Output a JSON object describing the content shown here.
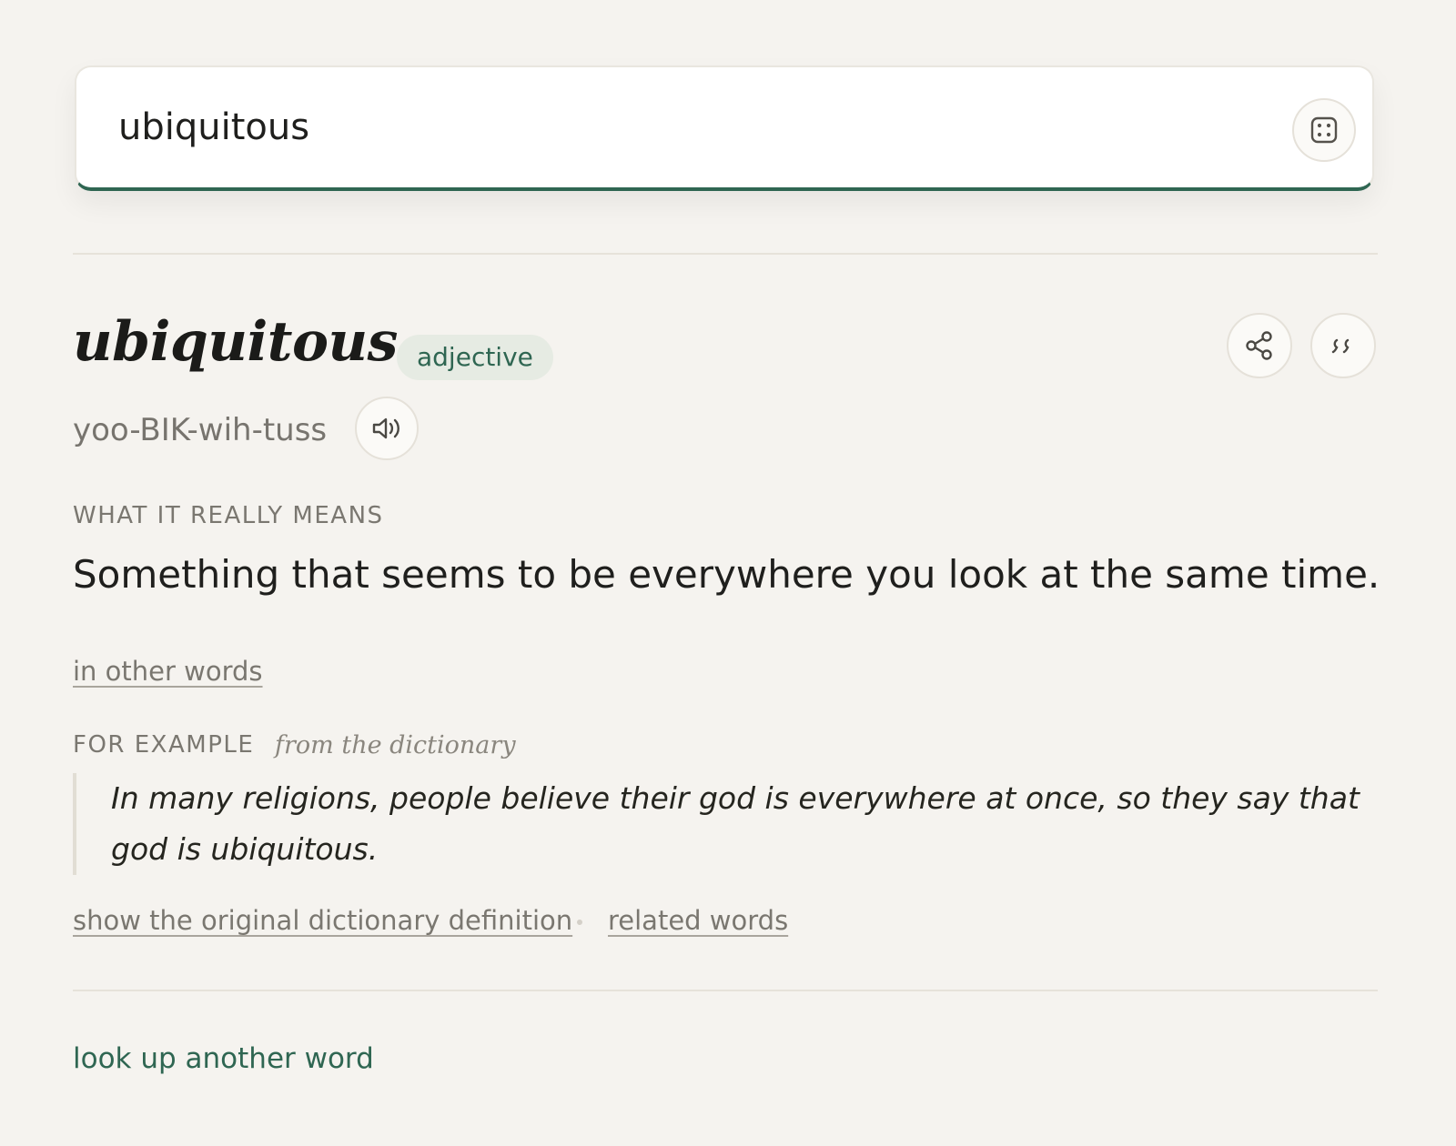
{
  "search": {
    "value": "ubiquitous",
    "random_button": "dice-icon"
  },
  "entry": {
    "word": "ubiquitous",
    "part_of_speech": "adjective",
    "pronunciation": "yoo-BIK-wih-tuss",
    "share_icon": "share-icon",
    "quote_icon": "quote-icon",
    "audio_icon": "speaker-icon",
    "meaning_label": "WHAT IT REALLY MEANS",
    "meaning": "Something that seems to be everywhere you look at the same time.",
    "in_other_words": "in other words",
    "example_label": "FOR EXAMPLE",
    "example_source": "from the dictionary",
    "example_text": "In many religions, people believe their god is everywhere at once, so they say that god is ubiquitous.",
    "show_original": "show the original dictionary definition",
    "related_words": "related words"
  },
  "footer": {
    "look_up_another": "look up another word"
  },
  "colors": {
    "accent": "#2f6652",
    "background": "#f5f3ef",
    "badge_bg": "#e6ebe3"
  }
}
